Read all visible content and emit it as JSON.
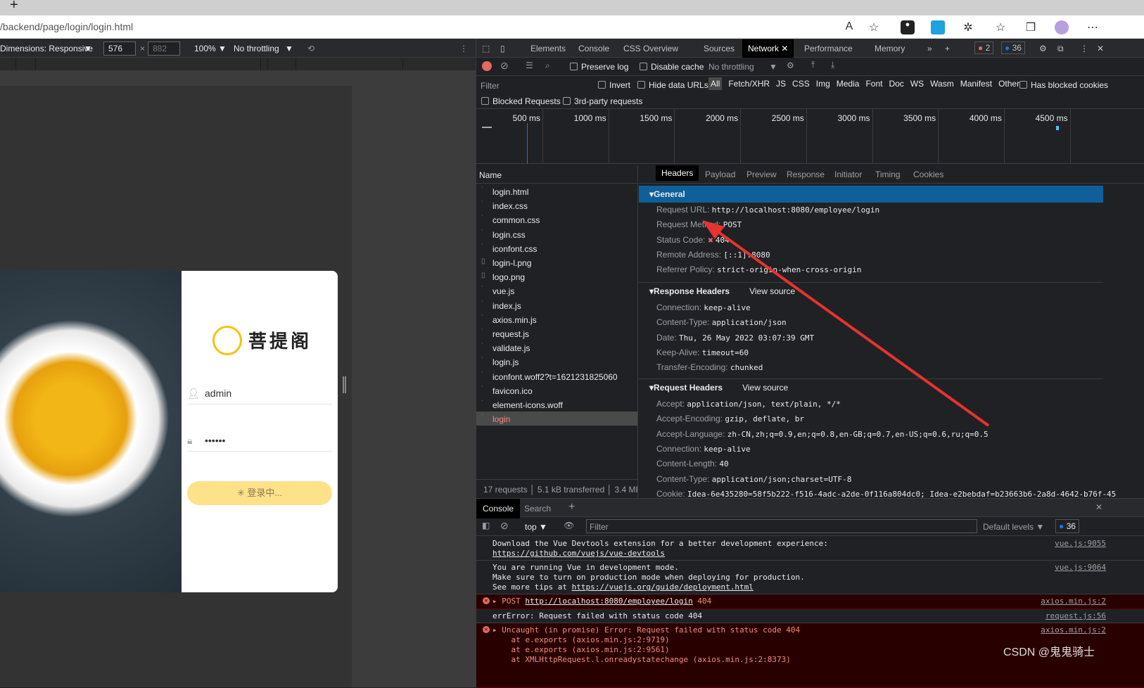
{
  "browser": {
    "url": "/backend/page/login/login.html"
  },
  "device_toolbar": {
    "dimensions": "Dimensions: Responsive",
    "width": "576",
    "height": "882",
    "zoom": "100%",
    "throttling": "No throttling"
  },
  "login": {
    "brand": "菩提阁",
    "username": "admin",
    "password": "••••••",
    "button": "登录中..."
  },
  "devtools": {
    "tabs": [
      "Elements",
      "Console",
      "CSS Overview",
      "Sources",
      "Network",
      "Performance",
      "Memory"
    ],
    "active_tab": "Network",
    "errors": "2",
    "messages": "36",
    "toolbar": {
      "preserve_log": "Preserve log",
      "disable_cache": "Disable cache",
      "throttling": "No throttling"
    },
    "filter": {
      "placeholder": "Filter",
      "invert": "Invert",
      "hide_data_urls": "Hide data URLs",
      "types": [
        "All",
        "Fetch/XHR",
        "JS",
        "CSS",
        "Img",
        "Media",
        "Font",
        "Doc",
        "WS",
        "Wasm",
        "Manifest",
        "Other"
      ],
      "has_blocked": "Has blocked cookies",
      "blocked_requests": "Blocked Requests",
      "third_party": "3rd-party requests"
    },
    "timeline_ticks": [
      "500 ms",
      "1000 ms",
      "1500 ms",
      "2000 ms",
      "2500 ms",
      "3000 ms",
      "3500 ms",
      "4000 ms",
      "4500 ms"
    ],
    "name_header": "Name",
    "requests": [
      "login.html",
      "index.css",
      "common.css",
      "login.css",
      "iconfont.css",
      "login-l.png",
      "logo.png",
      "vue.js",
      "index.js",
      "axios.min.js",
      "request.js",
      "validate.js",
      "login.js",
      "iconfont.woff2?t=1621231825060",
      "favicon.ico",
      "element-icons.woff",
      "login"
    ],
    "summary": {
      "requests": "17 requests",
      "transferred": "5.1 kB transferred",
      "resources": "3.4 MB"
    },
    "detail_tabs": [
      "Headers",
      "Payload",
      "Preview",
      "Response",
      "Initiator",
      "Timing",
      "Cookies"
    ],
    "general": {
      "title": "General",
      "rows": [
        [
          "Request URL:",
          "http://localhost:8080/employee/login"
        ],
        [
          "Request Method:",
          "POST"
        ],
        [
          "Status Code:",
          "404"
        ],
        [
          "Remote Address:",
          "[::1]:8080"
        ],
        [
          "Referrer Policy:",
          "strict-origin-when-cross-origin"
        ]
      ]
    },
    "response_headers": {
      "title": "Response Headers",
      "view_source": "View source",
      "rows": [
        [
          "Connection:",
          "keep-alive"
        ],
        [
          "Content-Type:",
          "application/json"
        ],
        [
          "Date:",
          "Thu, 26 May 2022 03:07:39 GMT"
        ],
        [
          "Keep-Alive:",
          "timeout=60"
        ],
        [
          "Transfer-Encoding:",
          "chunked"
        ]
      ]
    },
    "request_headers": {
      "title": "Request Headers",
      "view_source": "View source",
      "rows": [
        [
          "Accept:",
          "application/json, text/plain, */*"
        ],
        [
          "Accept-Encoding:",
          "gzip, deflate, br"
        ],
        [
          "Accept-Language:",
          "zh-CN,zh;q=0.9,en;q=0.8,en-GB;q=0.7,en-US;q=0.6,ru;q=0.5"
        ],
        [
          "Connection:",
          "keep-alive"
        ],
        [
          "Content-Length:",
          "40"
        ],
        [
          "Content-Type:",
          "application/json;charset=UTF-8"
        ],
        [
          "Cookie:",
          "Idea-6e435280=58f5b222-f516-4adc-a2de-0f116a804dc0; Idea-e2bebdaf=b23663b6-2a8d-4642-b76f-45"
        ]
      ]
    },
    "console": {
      "tabs": [
        "Console",
        "Search"
      ],
      "context": "top",
      "filter_placeholder": "Filter",
      "levels": "Default levels",
      "count": "36",
      "messages": [
        {
          "lines": [
            "Download the Vue Devtools extension for a better development experience:"
          ],
          "link": "https://github.com/vuejs/vue-devtools",
          "source": "vue.js:9055"
        },
        {
          "lines": [
            "You are running Vue in development mode.",
            "Make sure to turn on production mode when deploying for production."
          ],
          "prefix": "See more tips at ",
          "link": "https://vuejs.org/guide/deployment.html",
          "source": "vue.js:9064"
        },
        {
          "method": "POST",
          "link": "http://localhost:8080/employee/login",
          "status": "404",
          "source": "axios.min.js:2"
        },
        {
          "text": "errError: Request failed with status code 404",
          "source": "request.js:56"
        },
        {
          "text": "Uncaught (in promise) Error: Request failed with status code 404",
          "stack": [
            "at e.exports (axios.min.js:2:9719)",
            "at e.exports (axios.min.js:2:9561)",
            "at XMLHttpRequest.l.onreadystatechange (axios.min.js:2:8373)"
          ],
          "source": "axios.min.js:2"
        }
      ]
    }
  },
  "watermark": "CSDN @鬼鬼骑士",
  "colors": {
    "accent": "#1a73e8",
    "general_bg": "#0e5f9a",
    "error_bg": "#290000",
    "arrow": "#e8322f",
    "brand_yellow": "#f7c20f"
  }
}
